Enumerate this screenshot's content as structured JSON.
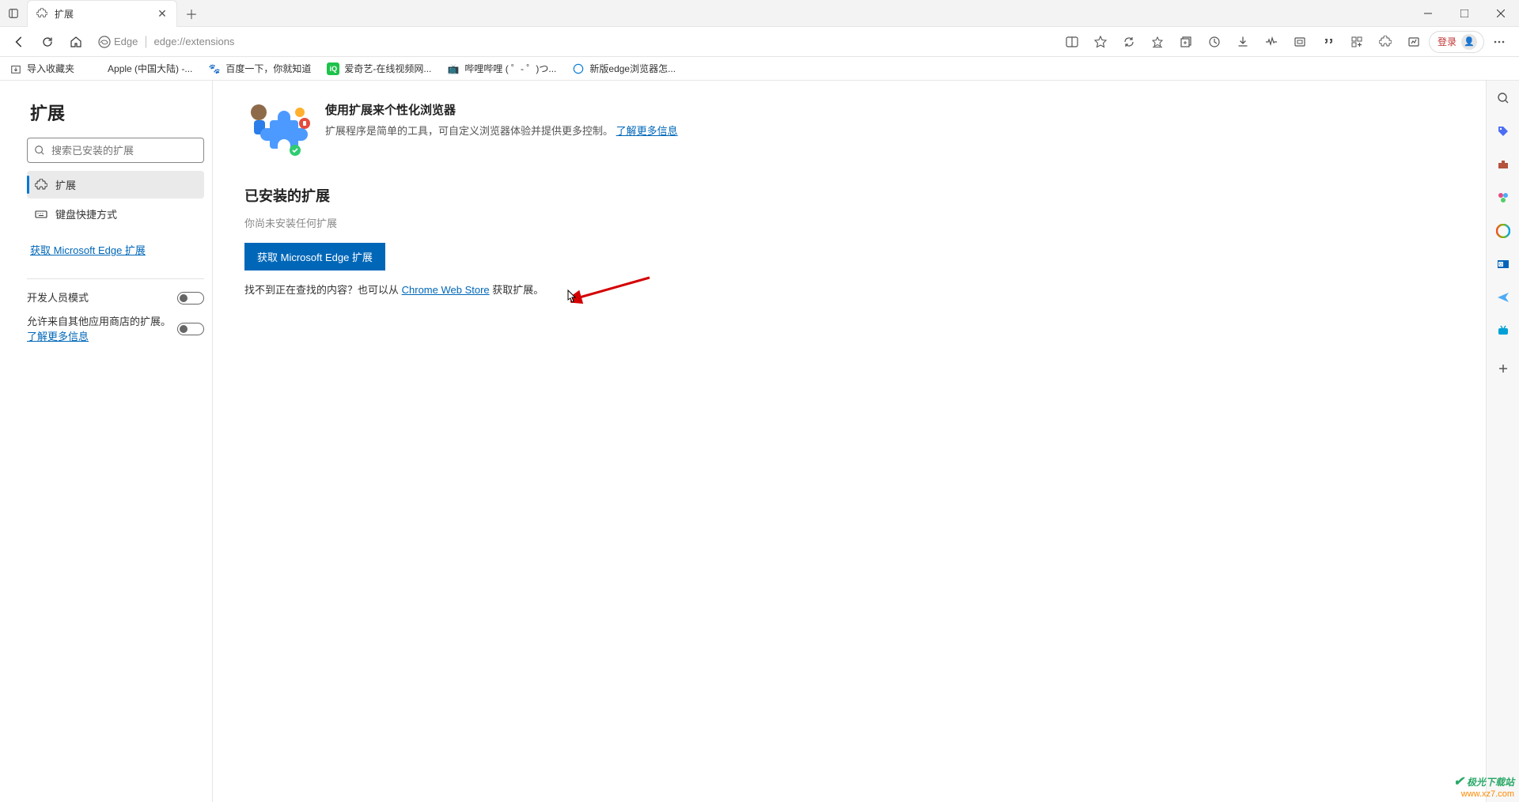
{
  "tab": {
    "title": "扩展"
  },
  "addressbar": {
    "edge_label": "Edge",
    "url": "edge://extensions"
  },
  "bookmarks": {
    "import": "导入收藏夹",
    "items": [
      "Apple (中国大陆) -...",
      "百度一下，你就知道",
      "爱奇艺-在线视频网...",
      "哔哩哔哩 (  ゜- ゜)つ...",
      "新版edge浏览器怎..."
    ]
  },
  "sidebar": {
    "title": "扩展",
    "search_placeholder": "搜索已安装的扩展",
    "nav": {
      "extensions": "扩展",
      "shortcuts": "键盘快捷方式"
    },
    "get_link": "获取 Microsoft Edge 扩展",
    "dev_mode": "开发人员模式",
    "allow_other_prefix": "允许来自其他应用商店的扩展。",
    "allow_other_link": "了解更多信息"
  },
  "main": {
    "hero_title": "使用扩展来个性化浏览器",
    "hero_desc_prefix": "扩展程序是简单的工具，可自定义浏览器体验并提供更多控制。",
    "hero_link": "了解更多信息",
    "section_title": "已安装的扩展",
    "empty": "你尚未安装任何扩展",
    "primary_btn": "获取 Microsoft Edge 扩展",
    "helper_prefix": "找不到正在查找的内容？也可以从 ",
    "helper_link": "Chrome Web Store",
    "helper_suffix": " 获取扩展。"
  },
  "login": {
    "label": "登录"
  },
  "watermark": {
    "line1": "极光下载站",
    "line2": "www.xz7.com"
  }
}
